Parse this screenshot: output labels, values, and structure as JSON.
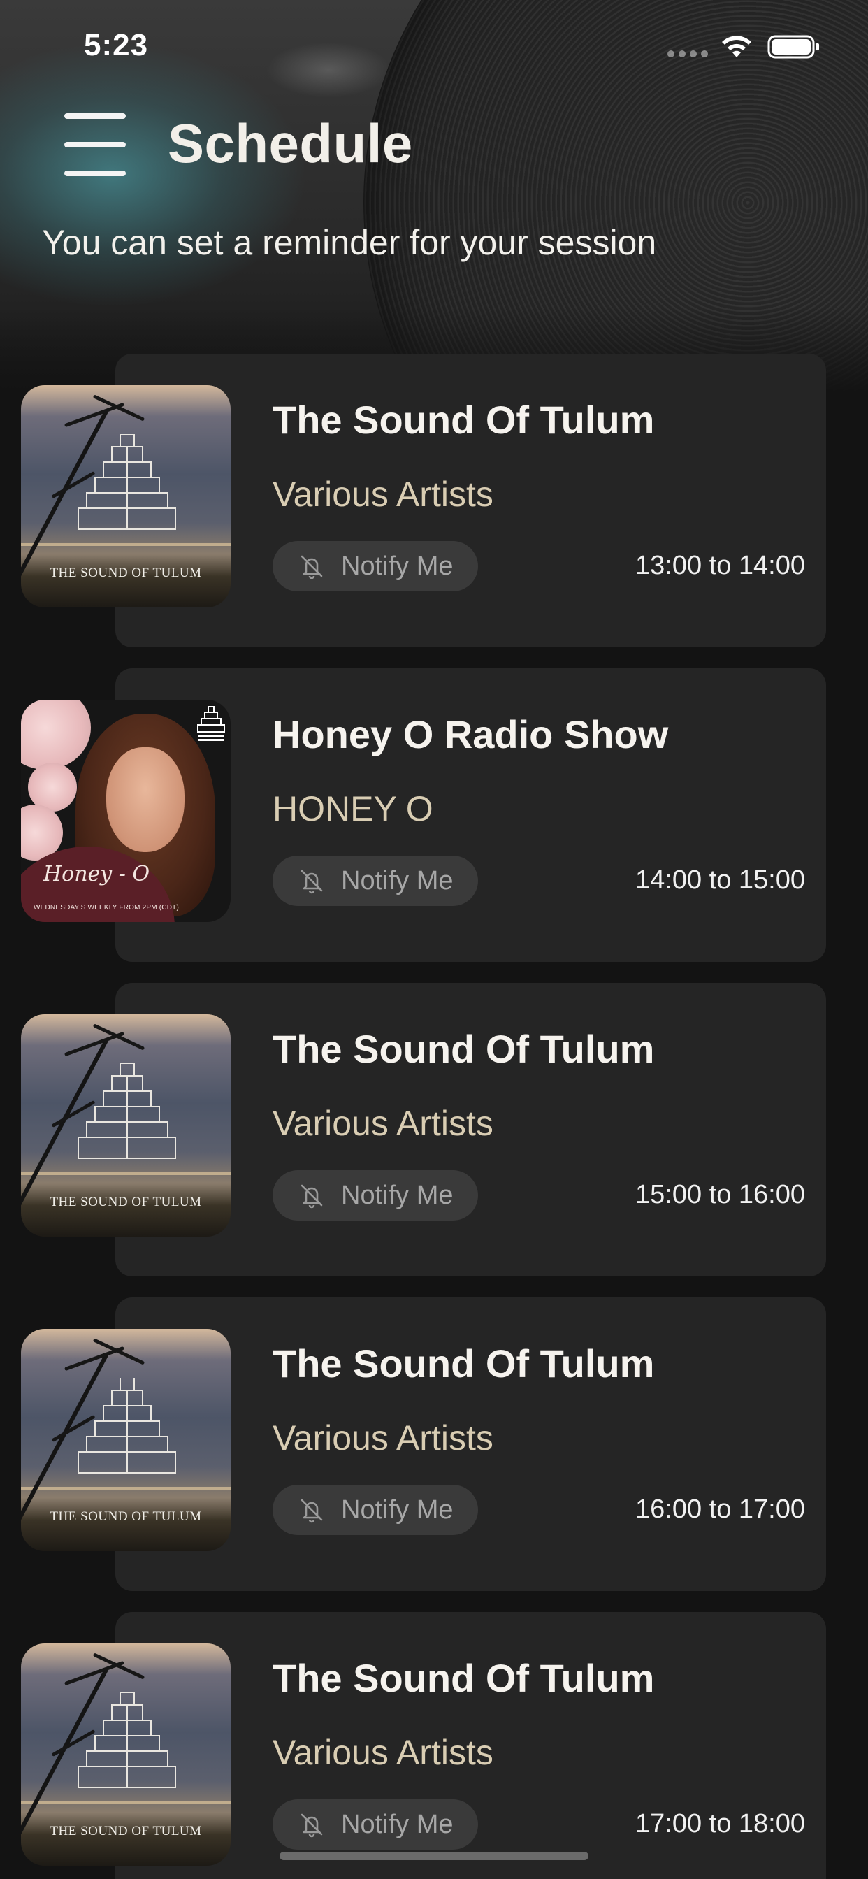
{
  "status_bar": {
    "time": "5:23"
  },
  "header": {
    "title": "Schedule",
    "subtitle": "You can set a reminder for your session"
  },
  "sessions": [
    {
      "title": "The Sound Of Tulum",
      "artist": "Various Artists",
      "notify_label": "Notify Me",
      "time_range": "13:00 to 14:00",
      "artwork": "tulum",
      "artwork_text": "THE SOUND OF TULUM"
    },
    {
      "title": "Honey O Radio Show",
      "artist": "HONEY O",
      "notify_label": "Notify Me",
      "time_range": "14:00 to 15:00",
      "artwork": "honey",
      "artwork_script": "Honey - O",
      "artwork_text": "WEDNESDAY'S WEEKLY FROM 2PM (CDT)"
    },
    {
      "title": "The Sound Of Tulum",
      "artist": "Various Artists",
      "notify_label": "Notify Me",
      "time_range": "15:00 to 16:00",
      "artwork": "tulum",
      "artwork_text": "THE SOUND OF TULUM"
    },
    {
      "title": "The Sound Of Tulum",
      "artist": "Various Artists",
      "notify_label": "Notify Me",
      "time_range": "16:00 to 17:00",
      "artwork": "tulum",
      "artwork_text": "THE SOUND OF TULUM"
    },
    {
      "title": "The Sound Of Tulum",
      "artist": "Various Artists",
      "notify_label": "Notify Me",
      "time_range": "17:00 to 18:00",
      "artwork": "tulum",
      "artwork_text": "THE SOUND OF TULUM"
    }
  ],
  "icons": {
    "menu": "hamburger-menu-icon",
    "notify": "bell-off-icon",
    "wifi": "wifi-icon",
    "battery": "battery-icon"
  },
  "colors": {
    "background": "#131313",
    "card": "#252525",
    "notify_button": "#3a3a3a",
    "artist_text": "#d9cdb3",
    "title_text": "#f6f3ee"
  }
}
